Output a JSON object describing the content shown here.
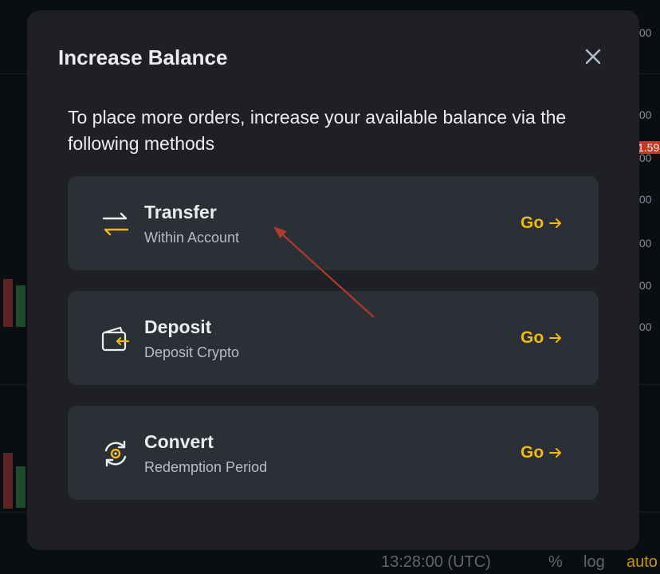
{
  "background": {
    "price_labels": [
      ".00",
      ".00",
      "1.59",
      ".00",
      ".00",
      ".00",
      ".00",
      ".00"
    ],
    "time_label": "13:28:00 (UTC)",
    "percent_label": "%",
    "log_label": "log",
    "auto_label": "auto"
  },
  "modal": {
    "title": "Increase Balance",
    "description": "To place more orders, increase your available balance via the following methods",
    "options": [
      {
        "title": "Transfer",
        "subtitle": "Within Account",
        "action": "Go",
        "icon": "transfer-icon"
      },
      {
        "title": "Deposit",
        "subtitle": "Deposit Crypto",
        "action": "Go",
        "icon": "wallet-deposit-icon"
      },
      {
        "title": "Convert",
        "subtitle": "Redemption Period",
        "action": "Go",
        "icon": "convert-icon"
      }
    ]
  },
  "colors": {
    "accent": "#f0b90b",
    "modal_bg": "#1e2026",
    "card_bg": "#2b2f36",
    "annotation": "#b03a2e"
  }
}
